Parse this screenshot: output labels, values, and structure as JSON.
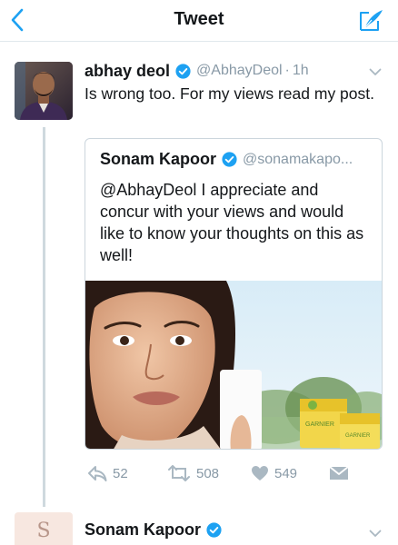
{
  "navbar": {
    "title": "Tweet"
  },
  "tweet": {
    "author_name": "abhay deol",
    "author_handle": "@AbhayDeol",
    "separator": "·",
    "time": "1h",
    "text": "Is wrong too. For my views read my post.",
    "quoted": {
      "author_name": "Sonam Kapoor",
      "author_handle": "@sonamakapo...",
      "text": "@AbhayDeol I appreciate and concur with your views and would like to know your thoughts on this as well!",
      "media": {
        "product_label": "GARNIER"
      }
    },
    "actions": {
      "replies": "52",
      "retweets": "508",
      "likes": "549"
    }
  },
  "next_tweet": {
    "author_name": "Sonam Kapoor",
    "avatar_letter": "S"
  },
  "colors": {
    "accent": "#1da1f2",
    "text": "#14171a",
    "secondary": "#8899a6",
    "border": "#ccd6dd"
  }
}
